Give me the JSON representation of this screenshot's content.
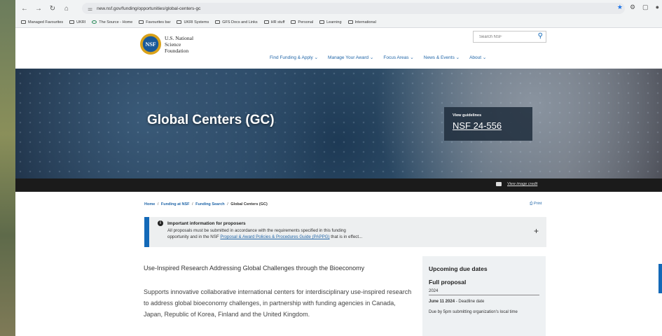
{
  "browser": {
    "url": "new.nsf.gov/funding/opportunities/global-centers-gc",
    "bookmarks": [
      "Managed Favourites",
      "UKRI",
      "The Source - Home",
      "Favourites bar",
      "UKRI Systems",
      "GFS Docs and Links",
      "HR stuff",
      "Personal",
      "Learning",
      "International"
    ]
  },
  "header": {
    "logo_line1": "U.S. National",
    "logo_line2": "Science",
    "logo_line3": "Foundation",
    "logo_seal": "NSF",
    "search_placeholder": "Search NSF",
    "menu": [
      "Find Funding & Apply ⌄",
      "Manage Your Award ⌄",
      "Focus Areas ⌄",
      "News & Events ⌄",
      "About ⌄"
    ]
  },
  "hero": {
    "title": "Global Centers (GC)",
    "guidelines_label": "View guidelines",
    "guidelines_link": "NSF 24-556",
    "credit_link": "View image credit"
  },
  "breadcrumb": {
    "home": "Home",
    "funding": "Funding at NSF",
    "search": "Funding Search",
    "current": "Global Centers (GC)",
    "separator": "/"
  },
  "print_label": "Print",
  "alert": {
    "title": "Important information for proposers",
    "line1": "All proposals must be submitted in accordance with the requirements specified in this funding",
    "line2_prefix": "opportunity and in the NSF ",
    "line2_link": "Proposal & Award Policies & Procedures Guide (PAPPG)",
    "line2_suffix": " that is in effect..."
  },
  "main": {
    "lead": "Use-Inspired Research Addressing Global Challenges through the Bioeconomy",
    "description": "Supports innovative collaborative international centers for interdisciplinary use-inspired research to address global bioeconomy challenges, in partnership with funding agencies in Canada, Japan, Republic of Korea, Finland and the United Kingdom."
  },
  "due_dates": {
    "heading": "Upcoming due dates",
    "type": "Full proposal",
    "year": "2024",
    "date": "June 11 2024",
    "date_suffix": " - Deadline date",
    "note": "Due by 5pm submitting organization's local time"
  },
  "colors": {
    "link": "#2166a8",
    "accent": "#1369b8",
    "alert_bg": "#edeff0"
  }
}
